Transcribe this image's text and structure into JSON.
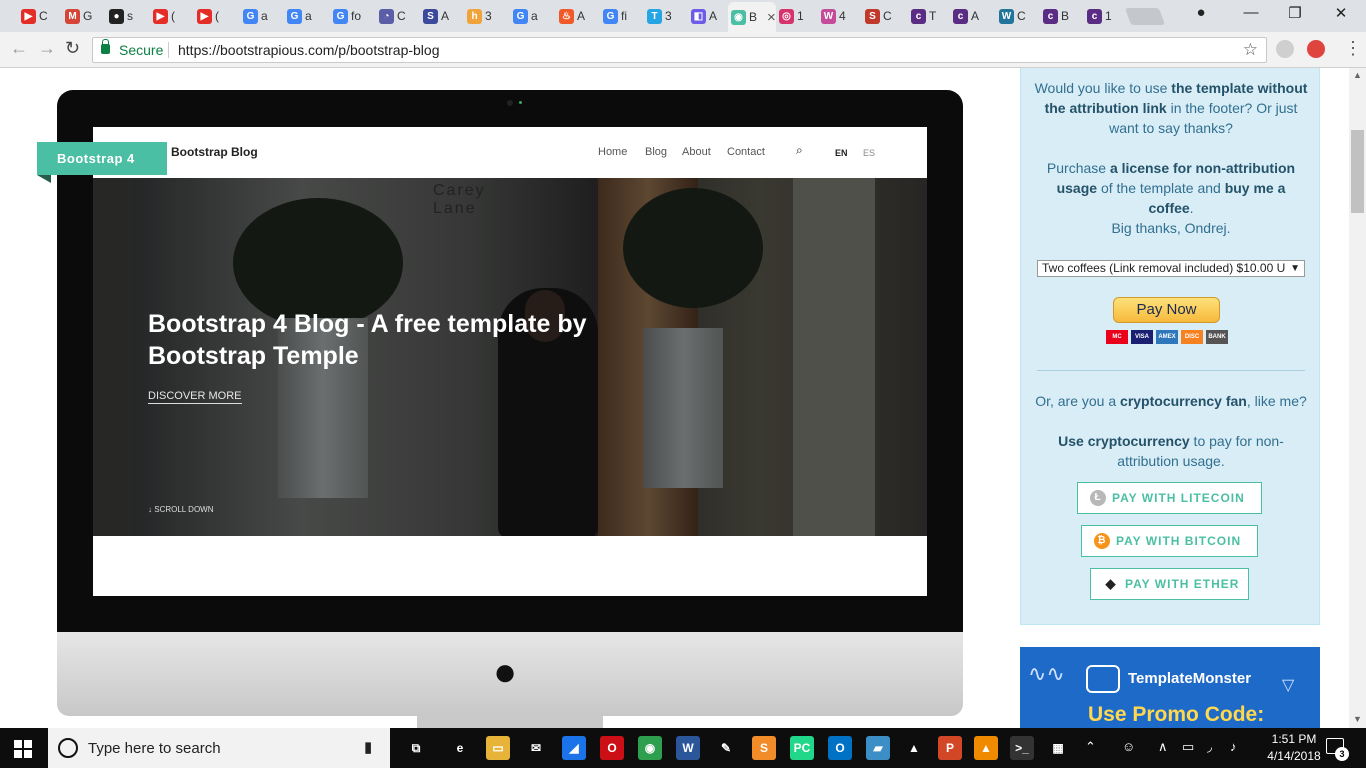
{
  "browser": {
    "tabs": [
      {
        "label": "C",
        "icon": "youtube-icon",
        "color": "#e52d27",
        "glyph": "▶"
      },
      {
        "label": "G",
        "icon": "gmail-icon",
        "color": "#d44638",
        "glyph": "M"
      },
      {
        "label": "s",
        "icon": "github-icon",
        "color": "#222222",
        "glyph": "●"
      },
      {
        "label": "(",
        "icon": "youtube-icon",
        "color": "#e52d27",
        "glyph": "▶"
      },
      {
        "label": "(",
        "icon": "youtube-icon",
        "color": "#e52d27",
        "glyph": "▶"
      },
      {
        "label": "a",
        "icon": "google-icon",
        "color": "#4285f4",
        "glyph": "G"
      },
      {
        "label": "a",
        "icon": "google-icon",
        "color": "#4285f4",
        "glyph": "G"
      },
      {
        "label": "fo",
        "icon": "google-icon",
        "color": "#4285f4",
        "glyph": "G"
      },
      {
        "label": "C",
        "icon": "satellite-icon",
        "color": "#5b5ea6",
        "glyph": "◔"
      },
      {
        "label": "A",
        "icon": "s-icon",
        "color": "#3b4a9a",
        "glyph": "S"
      },
      {
        "label": "3",
        "icon": "her-icon",
        "color": "#f0a33a",
        "glyph": "h"
      },
      {
        "label": "a",
        "icon": "google-icon",
        "color": "#4285f4",
        "glyph": "G"
      },
      {
        "label": "A",
        "icon": "fire-icon",
        "color": "#f05a28",
        "glyph": "♨"
      },
      {
        "label": "fi",
        "icon": "google-icon",
        "color": "#4285f4",
        "glyph": "G"
      },
      {
        "label": "3",
        "icon": "t-icon",
        "color": "#26a5e4",
        "glyph": "T"
      },
      {
        "label": "A",
        "icon": "shield-icon",
        "color": "#6c5ce7",
        "glyph": "◧"
      },
      {
        "label": "B",
        "icon": "bootstrapious-icon",
        "color": "#4bbfa3",
        "glyph": "◉",
        "active": true
      },
      {
        "label": "1",
        "icon": "circle-icon",
        "color": "#d6336c",
        "glyph": "◎"
      },
      {
        "label": "4",
        "icon": "w-icon",
        "color": "#c44c9b",
        "glyph": "W"
      },
      {
        "label": "C",
        "icon": "s-red-icon",
        "color": "#c0392b",
        "glyph": "S"
      },
      {
        "label": "T",
        "icon": "colorlib-icon",
        "color": "#5b2c83",
        "glyph": "c"
      },
      {
        "label": "A",
        "icon": "colorlib-icon",
        "color": "#5b2c83",
        "glyph": "c"
      },
      {
        "label": "C",
        "icon": "wordpress-icon",
        "color": "#21759b",
        "glyph": "W"
      },
      {
        "label": "B",
        "icon": "colorlib-icon",
        "color": "#5b2c83",
        "glyph": "c"
      },
      {
        "label": "1",
        "icon": "colorlib-icon",
        "color": "#5b2c83",
        "glyph": "c"
      }
    ],
    "window_controls": {
      "minimize": "—",
      "restore": "❐",
      "close": "✕"
    },
    "address": {
      "secure_label": "Secure",
      "url": "https://bootstrapious.com/p/bootstrap-blog"
    },
    "nav": {
      "back": "←",
      "forward": "→",
      "reload": "↻",
      "bookmark": "☆"
    }
  },
  "page": {
    "ribbon": "Bootstrap 4",
    "preview": {
      "brand": "Bootstrap Blog",
      "nav_links": [
        "Home",
        "Blog",
        "About",
        "Contact"
      ],
      "lang": [
        "EN",
        "ES"
      ],
      "sign_line1": "Carey",
      "sign_line2": "Lane",
      "hero_title": "Bootstrap 4 Blog - A free template by Bootstrap Temple",
      "discover": "DISCOVER MORE",
      "scroll": "SCROLL DOWN"
    },
    "sidebar": {
      "q1_pre": "Would you like to use ",
      "q1_bold": "the template without the attribution link",
      "q1_post": " in the footer? Or just want to say thanks?",
      "p_pre": "Purchase ",
      "p_bold1": "a license for non-attribution usage",
      "p_mid": " of the template and ",
      "p_bold2": "buy me a coffee",
      "p_post": ".",
      "thanks": "Big thanks, Ondrej.",
      "select_value": "Two coffees (Link removal included) $10.00 U",
      "pay_now": "Pay Now",
      "cards": [
        "MC",
        "VISA",
        "AMEX",
        "DISC",
        "BANK"
      ],
      "crypto_pre": "Or, are you a ",
      "crypto_bold": "cryptocurrency fan",
      "crypto_post": ", like me?",
      "use_bold": "Use cryptocurrency",
      "use_post": " to pay for non-attribution usage.",
      "buttons": [
        "PAY WITH LITECOIN",
        "PAY WITH BITCOIN",
        "PAY WITH ETHER"
      ]
    },
    "ad": {
      "brand": "TemplateMonster",
      "promo": "Use Promo Code:"
    }
  },
  "taskbar": {
    "search_placeholder": "Type here to search",
    "apps": [
      {
        "name": "task-view-icon",
        "glyph": "⧉",
        "color": "#0d0d0d"
      },
      {
        "name": "edge-icon",
        "glyph": "e",
        "color": "#0d0d0d"
      },
      {
        "name": "file-explorer-icon",
        "glyph": "▭",
        "color": "#e8b339"
      },
      {
        "name": "mail-icon",
        "glyph": "✉",
        "color": "#0d0d0d"
      },
      {
        "name": "app-blue-icon",
        "glyph": "◢",
        "color": "#1a73e8"
      },
      {
        "name": "opera-icon",
        "glyph": "O",
        "color": "#cc0f16"
      },
      {
        "name": "chrome-icon",
        "glyph": "◉",
        "color": "#2e9e4f"
      },
      {
        "name": "word-icon",
        "glyph": "W",
        "color": "#2b579a"
      },
      {
        "name": "paint-icon",
        "glyph": "✎",
        "color": "#0d0d0d"
      },
      {
        "name": "sublime-icon",
        "glyph": "S",
        "color": "#f28c28"
      },
      {
        "name": "pycharm-icon",
        "glyph": "PC",
        "color": "#21d789"
      },
      {
        "name": "outlook-icon",
        "glyph": "O",
        "color": "#0072c6"
      },
      {
        "name": "app-book-icon",
        "glyph": "▰",
        "color": "#3c8ec7"
      },
      {
        "name": "photos-icon",
        "glyph": "▲",
        "color": "#0d0d0d"
      },
      {
        "name": "powerpoint-icon",
        "glyph": "P",
        "color": "#d24726"
      },
      {
        "name": "vlc-icon",
        "glyph": "▲",
        "color": "#f08a00"
      },
      {
        "name": "terminal-icon",
        "glyph": ">_",
        "color": "#333333"
      },
      {
        "name": "clapper-icon",
        "glyph": "▦",
        "color": "#0d0d0d"
      }
    ],
    "time": "1:51 PM",
    "date": "4/14/2018",
    "notifications": "3"
  }
}
